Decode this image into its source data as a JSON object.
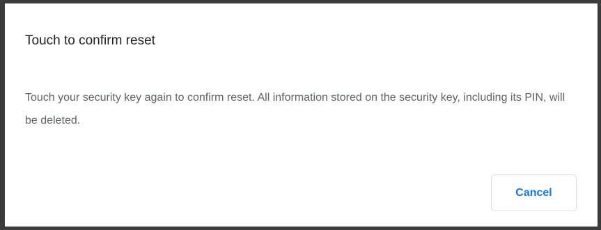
{
  "dialog": {
    "title": "Touch to confirm reset",
    "body": "Touch your security key again to confirm reset. All information stored on the security key, including its PIN, will be deleted.",
    "cancel_label": "Cancel"
  },
  "colors": {
    "backdrop": "#3c3c3c",
    "title_text": "#202124",
    "body_text": "#5f6368",
    "button_text": "#1a73e8",
    "button_border": "#dadce0"
  }
}
